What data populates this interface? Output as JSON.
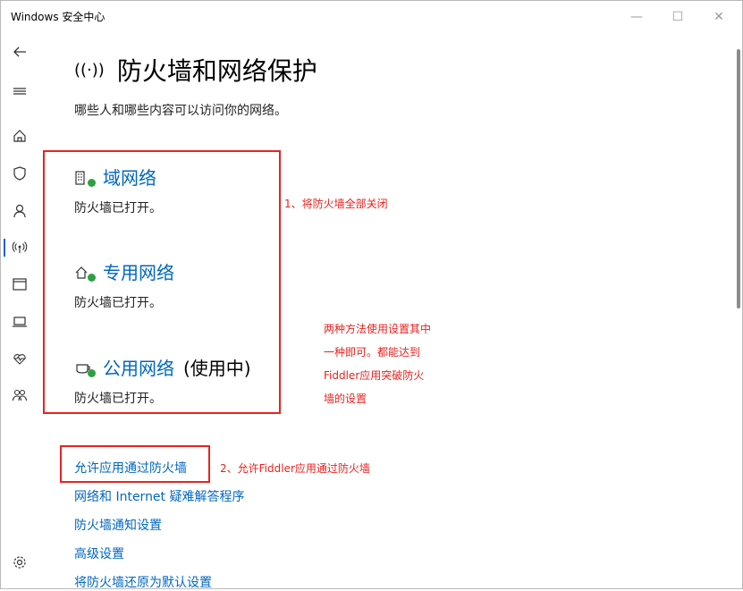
{
  "window": {
    "title": "Windows 安全中心",
    "minimize": "—",
    "maximize": "☐",
    "close": "✕"
  },
  "sidebar": [
    {
      "name": "back-icon",
      "active": false
    },
    {
      "name": "menu-icon",
      "active": false
    },
    {
      "name": "home-icon",
      "active": false
    },
    {
      "name": "shield-icon",
      "active": false
    },
    {
      "name": "account-icon",
      "active": false
    },
    {
      "name": "firewall-icon",
      "active": true
    },
    {
      "name": "app-browser-icon",
      "active": false
    },
    {
      "name": "device-security-icon",
      "active": false
    },
    {
      "name": "device-health-icon",
      "active": false
    },
    {
      "name": "family-icon",
      "active": false
    },
    {
      "name": "settings-icon",
      "active": false
    }
  ],
  "page": {
    "icon": "((·))",
    "title": "防火墙和网络保护",
    "subtitle": "哪些人和哪些内容可以访问你的网络。"
  },
  "networks": [
    {
      "name": "域网络",
      "status": "防火墙已打开。",
      "in_use": ""
    },
    {
      "name": "专用网络",
      "status": "防火墙已打开。",
      "in_use": ""
    },
    {
      "name": "公用网络",
      "status": "防火墙已打开。",
      "in_use": "(使用中)"
    }
  ],
  "links": [
    "允许应用通过防火墙",
    "网络和 Internet 疑难解答程序",
    "防火墙通知设置",
    "高级设置",
    "将防火墙还原为默认设置"
  ],
  "annotations": {
    "note1": "1、将防火墙全部关闭",
    "note2": "2、允许Fiddler应用通过防火墙",
    "note3_lines": [
      "两种方法使用设置其中",
      "一种即可。都能达到",
      "Fiddler应用突破防火",
      "墙的设置"
    ]
  }
}
